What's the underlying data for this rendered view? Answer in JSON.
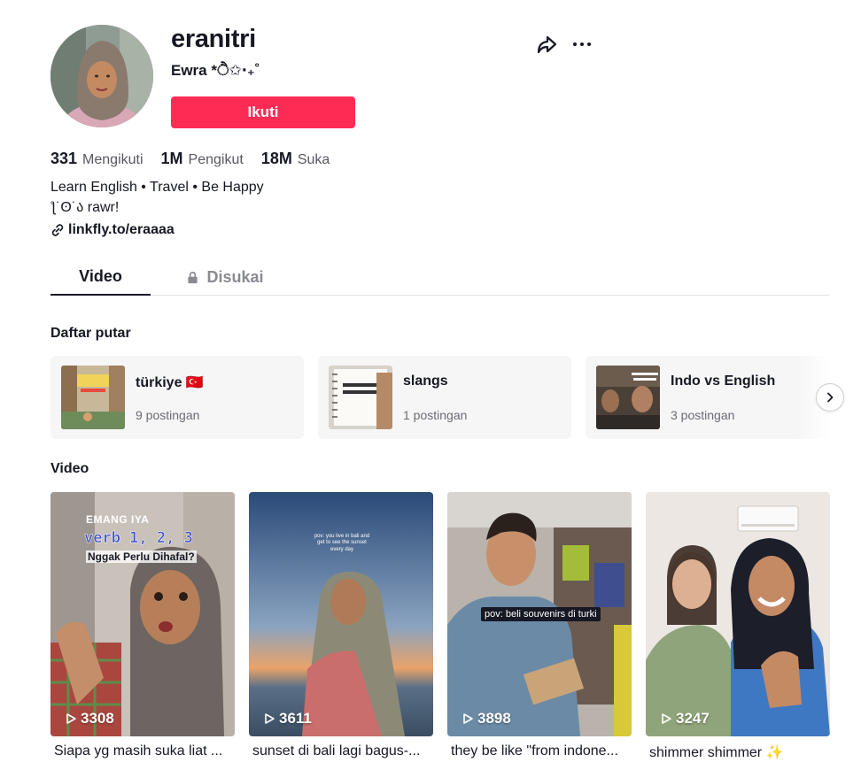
{
  "profile": {
    "username": "eranitri",
    "nickname": "Ewra *ੈ✩‧₊˚",
    "follow_label": "Ikuti",
    "stats": [
      {
        "value": "331",
        "label": "Mengikuti"
      },
      {
        "value": "1M",
        "label": "Pengikut"
      },
      {
        "value": "18M",
        "label": "Suka"
      }
    ],
    "bio_line1": "Learn English • Travel • Be Happy",
    "bio_line2": "ƪ˙ʘ˙ა rawr!",
    "link": "linkfly.to/eraaaa"
  },
  "tabs": {
    "video": "Video",
    "liked": "Disukai"
  },
  "playlists_title": "Daftar putar",
  "playlists": [
    {
      "name": "türkiye 🇹🇷",
      "count": "9 postingan"
    },
    {
      "name": "slangs",
      "count": "1 postingan"
    },
    {
      "name": "Indo vs English",
      "count": "3 postingan"
    }
  ],
  "videos_title": "Video",
  "videos": [
    {
      "views": "3308",
      "caption": "Siapa yg masih suka liat ...",
      "overlay": [
        "EMANG IYA",
        "verb 1, 2, 3",
        "Nggak Perlu Dihafal?"
      ]
    },
    {
      "views": "3611",
      "caption": "sunset di bali lagi bagus-...",
      "overlay": [
        "pov: you live in bali and",
        "get to see the sunset",
        "every day"
      ]
    },
    {
      "views": "3898",
      "caption": "they be like \"from indone...",
      "overlay": [
        "pov: beli souvenirs di turki"
      ]
    },
    {
      "views": "3247",
      "caption": "shimmer shimmer ✨",
      "overlay": []
    }
  ],
  "colors": {
    "accent": "#fe2c55",
    "text": "#161823",
    "muted": "#57585f"
  }
}
